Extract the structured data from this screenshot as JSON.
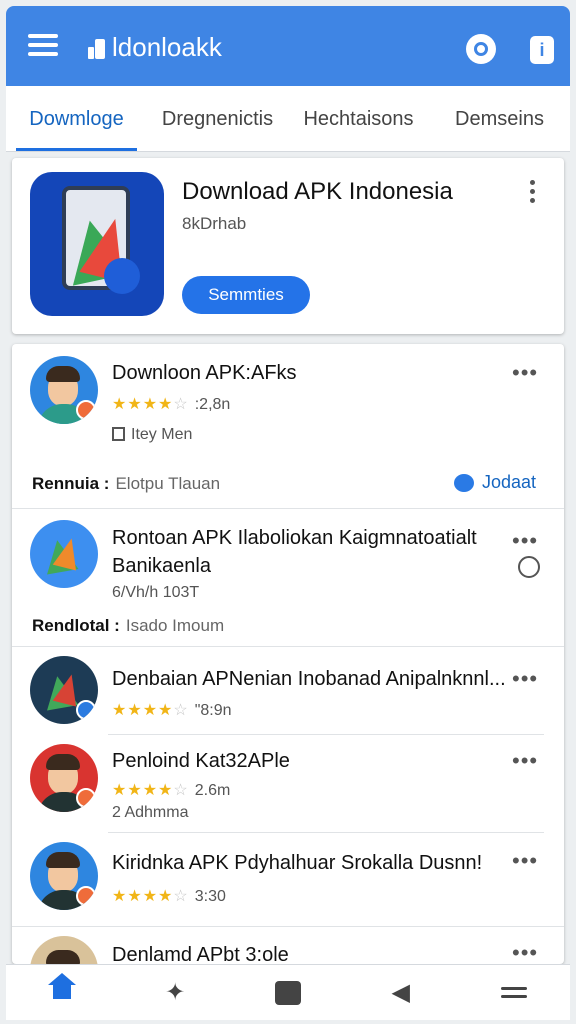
{
  "app": {
    "title": "ldonloakk"
  },
  "tabs": [
    "Dowmloge",
    "Dregnenictis",
    "Hechtaisons",
    "Demseins"
  ],
  "featured": {
    "title": "Download APK Indonesia",
    "subtitle": "8kDrhab",
    "button_label": "Semmties"
  },
  "list": [
    {
      "title": "Downloon APK:AFks",
      "rating": 4,
      "meta": ":2,8n",
      "sub": "Itey Men",
      "footer_label": "Rennuia :",
      "footer_value": "Elotpu Tlauan",
      "action": "Jodaat"
    },
    {
      "title": "Rontoan APK Ilaboliokan Kaigmnatoatialt Banikaenla",
      "meta": "6/Vh/h 103T",
      "footer_label": "Rendlotal :",
      "footer_value": "Isado Imoum"
    },
    {
      "title": "Denbaian APNenian Inobanad Anipalnknnl...",
      "rating": 4,
      "meta": "\"8:9n"
    },
    {
      "title": "Penloind Kat32APle",
      "rating": 4,
      "meta": "2.6m",
      "sub": "2 Adhmma"
    },
    {
      "title": "Kiridnka APK Pdyhalhuar Srokalla Dusnn!",
      "rating": 4,
      "meta": "3:30"
    },
    {
      "title": "Denlamd APbt 3:ole"
    }
  ],
  "more_glyph": "•••",
  "stars": {
    "filled": "★★★★",
    "empty": "☆"
  },
  "colors": {
    "primary": "#3f85e4",
    "accent": "#1e6fe0",
    "star": "#f1b517"
  },
  "bottom_nav": [
    "home-icon",
    "puzzle-icon",
    "chat-icon",
    "back-icon",
    "menu-icon"
  ]
}
